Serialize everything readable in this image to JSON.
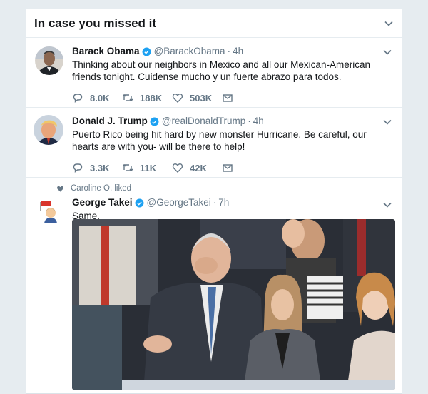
{
  "section": {
    "title": "In case you missed it"
  },
  "colors": {
    "verified": "#1da1f2",
    "icon_gray": "#657786",
    "like_gray": "#657786"
  },
  "tweets": [
    {
      "name": "Barack Obama",
      "handle": "@BarackObama",
      "separator": "·",
      "time": "4h",
      "text": "Thinking about our neighbors in Mexico and all our Mexican-American friends tonight. Cuidense mucho y un fuerte abrazo para todos.",
      "replies": "8.0K",
      "retweets": "188K",
      "likes": "503K",
      "icons": [
        "reply-icon",
        "retweet-icon",
        "like-icon",
        "direct-message-icon"
      ]
    },
    {
      "name": "Donald J. Trump",
      "handle": "@realDonaldTrump",
      "separator": "·",
      "time": "4h",
      "text": "Puerto Rico being hit hard by new monster Hurricane. Be careful, our hearts are with you- will be there to help!",
      "replies": "3.3K",
      "retweets": "11K",
      "likes": "42K"
    },
    {
      "social_context": "Caroline O. liked",
      "name": "George Takei",
      "handle": "@GeorgeTakei",
      "separator": "·",
      "time": "7h",
      "text": "Same."
    }
  ]
}
